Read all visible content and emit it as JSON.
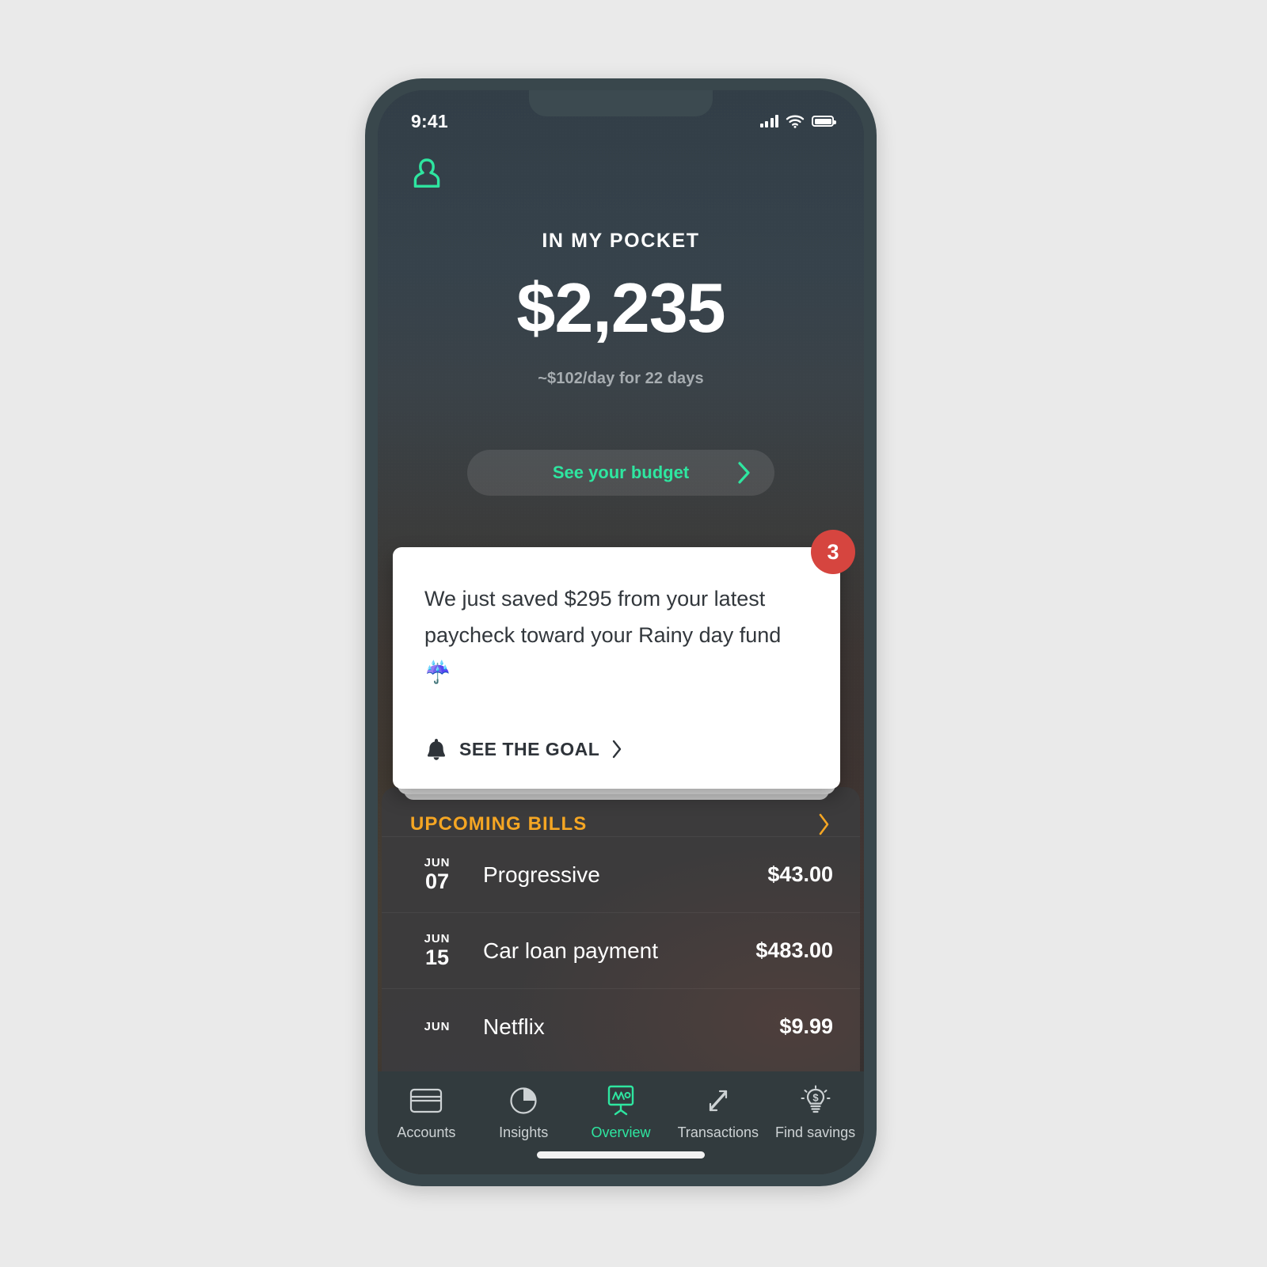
{
  "theme": {
    "accent_green": "#2ee6a0",
    "accent_amber": "#f5a623",
    "badge_red": "#d6453f",
    "frame": "#39474c",
    "page_bg": "#eaeaea"
  },
  "status_bar": {
    "time": "9:41",
    "signal_icon": "cellular-signal-icon",
    "wifi_icon": "wifi-icon",
    "battery_icon": "battery-full-icon"
  },
  "header": {
    "profile_icon": "profile-icon"
  },
  "hero": {
    "title": "IN MY POCKET",
    "amount": "$2,235",
    "subtitle": "~$102/day for 22 days"
  },
  "budget_button": {
    "label": "See your budget",
    "chevron_icon": "chevron-right-icon"
  },
  "notification": {
    "badge_count": "3",
    "message": "We just saved $295 from your latest paycheck toward your Rainy day fund ☔",
    "cta_label": "SEE THE GOAL",
    "cta_icon": "bell-icon",
    "cta_chevron": "chevron-right-icon"
  },
  "bills": {
    "title": "UPCOMING BILLS",
    "chevron_icon": "chevron-right-icon",
    "items": [
      {
        "month": "JUN",
        "day": "07",
        "name": "Progressive",
        "amount": "$43.00"
      },
      {
        "month": "JUN",
        "day": "15",
        "name": "Car loan payment",
        "amount": "$483.00"
      },
      {
        "month": "JUN",
        "day": "",
        "name": "Netflix",
        "amount": "$9.99"
      }
    ]
  },
  "tabbar": {
    "items": [
      {
        "label": "Accounts",
        "icon": "credit-card-icon",
        "active": false
      },
      {
        "label": "Insights",
        "icon": "pie-chart-icon",
        "active": false
      },
      {
        "label": "Overview",
        "icon": "chart-board-icon",
        "active": true
      },
      {
        "label": "Transactions",
        "icon": "transfer-arrows-icon",
        "active": false
      },
      {
        "label": "Find savings",
        "icon": "lightbulb-dollar-icon",
        "active": false
      }
    ]
  }
}
